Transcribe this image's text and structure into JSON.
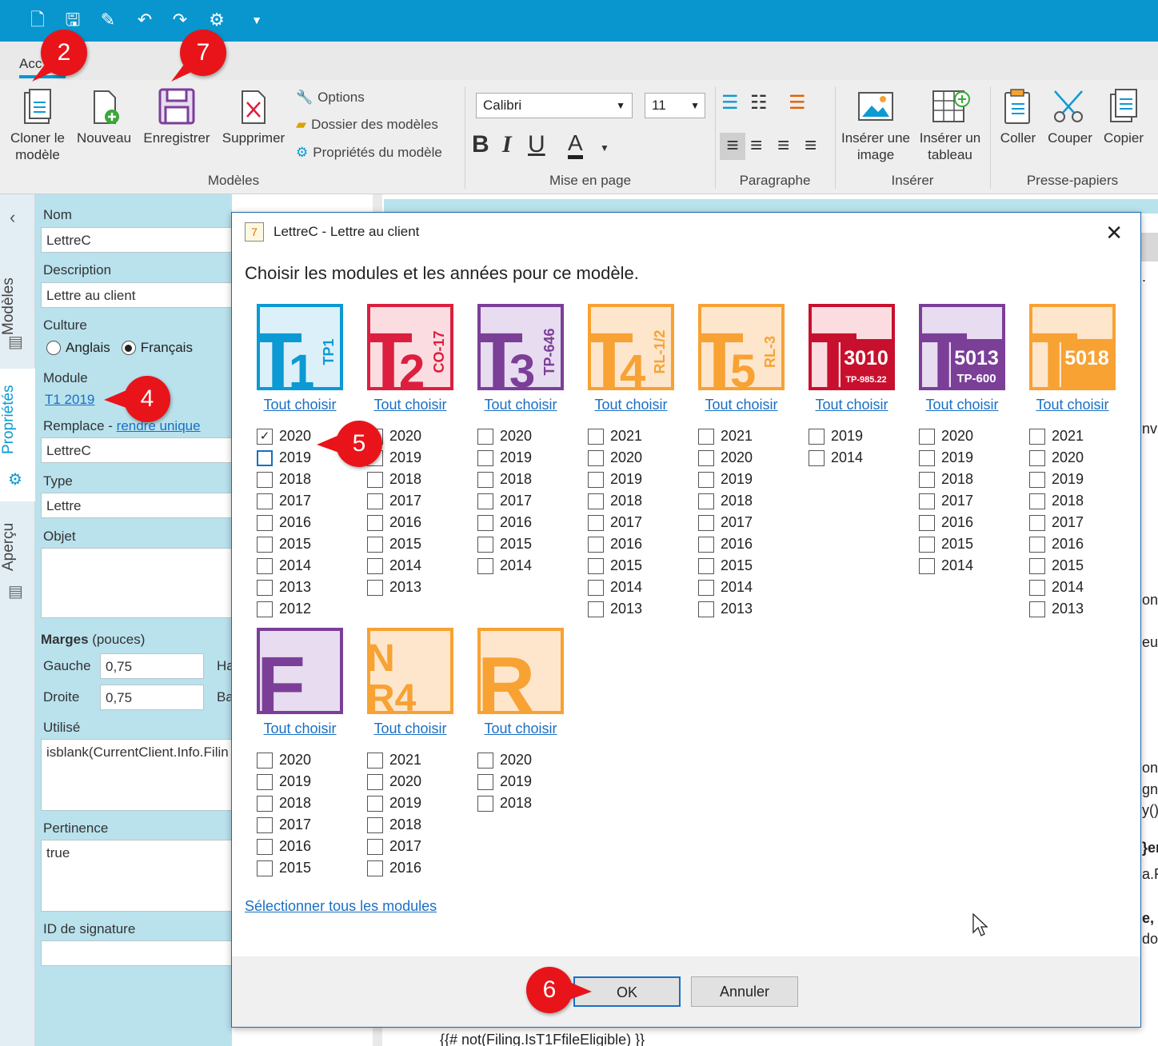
{
  "ribbon": {
    "tab_label": "Acc",
    "clone_label": "Cloner le modèle",
    "new_label": "Nouveau",
    "save_label": "Enregistrer",
    "delete_label": "Supprimer",
    "options_label": "Options",
    "folder_label": "Dossier des modèles",
    "template_props_label": "Propriétés du modèle",
    "group_templates": "Modèles",
    "font_name": "Calibri",
    "font_size": "11",
    "bold": "B",
    "italic": "I",
    "underline": "U",
    "font_color": "A",
    "group_layout": "Mise en page",
    "group_paragraph": "Paragraphe",
    "insert_image_label": "Insérer une image",
    "insert_table_label": "Insérer un tableau",
    "group_insert": "Insérer",
    "paste_label": "Coller",
    "cut_label": "Couper",
    "copy_label": "Copier",
    "group_clipboard": "Presse-papiers"
  },
  "sidebar": {
    "tab_models": "Modèles",
    "tab_properties": "Propriétés",
    "tab_preview": "Aperçu"
  },
  "properties": {
    "name_label": "Nom",
    "name_value": "LettreC",
    "description_label": "Description",
    "description_value": "Lettre au client",
    "culture_label": "Culture",
    "culture_english": "Anglais",
    "culture_french": "Français",
    "module_label": "Module",
    "module_value": "T1 2019",
    "replaces_label": "Remplace -",
    "make_unique_link": "rendre unique",
    "replaces_value": "LettreC",
    "type_label": "Type",
    "type_value": "Lettre",
    "object_label": "Objet",
    "margins_label": "Marges",
    "margins_unit": "(pouces)",
    "left_label": "Gauche",
    "left_value": "0,75",
    "top_label_partial": "Ha",
    "right_label": "Droite",
    "right_value": "0,75",
    "bottom_label_partial": "Ba",
    "used_label": "Utilisé",
    "used_value": "isblank(CurrentClient.Info.Filin",
    "relevance_label": "Pertinence",
    "relevance_value": "true",
    "signature_label": "ID de signature"
  },
  "dialog": {
    "title": "LettreC - Lettre au client",
    "heading": "Choisir les modules et les années pour ce modèle.",
    "select_all_label": "Tout choisir",
    "select_all_modules": "Sélectionner tous les modules",
    "ok_label": "OK",
    "cancel_label": "Annuler",
    "modules": [
      {
        "id": "T1",
        "logo_main": "T1",
        "logo_sub": "TP1",
        "color": "#0b9ad3",
        "bg": "#dcf0fa",
        "years": [
          "2020",
          "2019",
          "2018",
          "2017",
          "2016",
          "2015",
          "2014",
          "2013",
          "2012"
        ],
        "checked": [
          "2020"
        ]
      },
      {
        "id": "T2",
        "logo_main": "T2",
        "logo_sub": "CO-17",
        "color": "#dc1f3f",
        "bg": "#fbdde1",
        "years": [
          "2020",
          "2019",
          "2018",
          "2017",
          "2016",
          "2015",
          "2014",
          "2013"
        ],
        "checked": []
      },
      {
        "id": "T3",
        "logo_main": "T3",
        "logo_sub": "TP-646",
        "color": "#7b3f98",
        "bg": "#e7dcf0",
        "years": [
          "2020",
          "2019",
          "2018",
          "2017",
          "2016",
          "2015",
          "2014"
        ],
        "checked": []
      },
      {
        "id": "T4",
        "logo_main": "T4",
        "logo_sub": "RL-1/2",
        "color": "#f7a233",
        "bg": "#fde6cc",
        "years": [
          "2021",
          "2020",
          "2019",
          "2018",
          "2017",
          "2016",
          "2015",
          "2014",
          "2013"
        ],
        "checked": []
      },
      {
        "id": "T5",
        "logo_main": "T5",
        "logo_sub": "RL-3",
        "color": "#f7a233",
        "bg": "#fde6cc",
        "years": [
          "2021",
          "2020",
          "2019",
          "2018",
          "2017",
          "2016",
          "2015",
          "2014",
          "2013"
        ],
        "checked": []
      },
      {
        "id": "T3010",
        "logo_main": "T",
        "logo_num": "3010",
        "logo_sub": "TP-985.22",
        "color": "#c8102e",
        "bg": "#fbdde1",
        "years": [
          "2019",
          "2014"
        ],
        "checked": []
      },
      {
        "id": "T5013",
        "logo_main": "T",
        "logo_num": "5013",
        "logo_sub": "TP-600",
        "color": "#7b3f98",
        "bg": "#e7dcf0",
        "years": [
          "2020",
          "2019",
          "2018",
          "2017",
          "2016",
          "2015",
          "2014"
        ],
        "checked": []
      },
      {
        "id": "T5018",
        "logo_main": "T",
        "logo_num": "5018",
        "logo_sub": "",
        "color": "#f7a233",
        "bg": "#fde6cc",
        "years": [
          "2021",
          "2020",
          "2019",
          "2018",
          "2017",
          "2016",
          "2015",
          "2014",
          "2013"
        ],
        "checked": []
      },
      {
        "id": "F",
        "logo_main": "F",
        "logo_sub": "",
        "color": "#7b3f98",
        "bg": "#e7dcf0",
        "years": [
          "2020",
          "2019",
          "2018",
          "2017",
          "2016",
          "2015"
        ],
        "checked": []
      },
      {
        "id": "NR4",
        "logo_main": "NR4",
        "logo_sub": "",
        "color": "#f7a233",
        "bg": "#fde6cc",
        "years": [
          "2021",
          "2020",
          "2019",
          "2018",
          "2017",
          "2016"
        ],
        "checked": []
      },
      {
        "id": "R",
        "logo_main": "R",
        "logo_sub": "",
        "color": "#f7a233",
        "bg": "#fde6cc",
        "years": [
          "2020",
          "2019",
          "2018"
        ],
        "checked": []
      }
    ]
  },
  "callouts": [
    "2",
    "7",
    "4",
    "5",
    "6"
  ],
  "document_fragments": [
    ".",
    "nv",
    "on'",
    "eur",
    "on'",
    "gné",
    "y()",
    "}er",
    "a.F",
    "e,",
    "do",
    "{{# not(Filing.IsT1FfileEligible) }}"
  ]
}
